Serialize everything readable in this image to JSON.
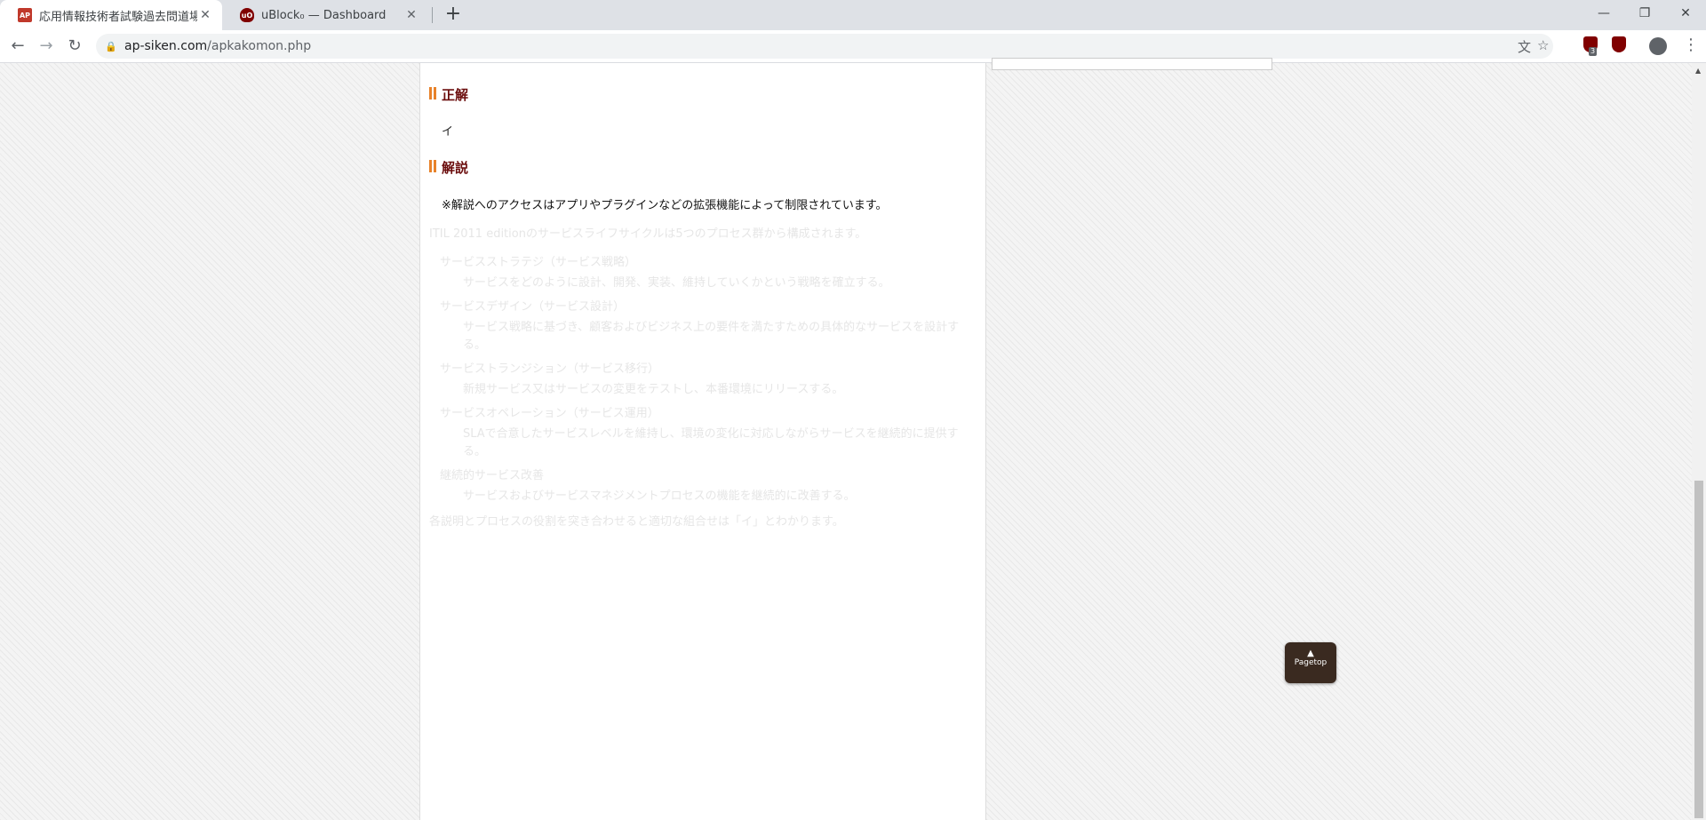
{
  "tabs": [
    {
      "title": "応用情報技術者試験過去問道場",
      "favicon": "AP",
      "close": "✕"
    },
    {
      "title": "uBlock₀ — Dashboard",
      "favicon": "uO",
      "close": "✕"
    }
  ],
  "new_tab_icon": "+",
  "window_controls": {
    "minimize": "—",
    "maximize": "❐",
    "close": "✕"
  },
  "nav": {
    "back": "←",
    "forward": "→",
    "reload": "↻"
  },
  "address": {
    "host": "ap-siken.com",
    "path": "/apkakomon.php",
    "lock_icon": "lock-icon"
  },
  "extensions": {
    "ublock_badge": "3"
  },
  "page": {
    "answer_heading": "正解",
    "answer": "イ",
    "explanation_heading": "解説",
    "notice": "※解説へのアクセスはアプリやプラグインなどの拡張機能によって制限されています。",
    "faded_intro": "ITIL 2011 editionのサービスライフサイクルは5つのプロセス群から構成されます。",
    "faded_items": [
      {
        "term": "サービスストラテジ（サービス戦略）",
        "desc": "サービスをどのように設計、開発、実装、維持していくかという戦略を確立する。"
      },
      {
        "term": "サービスデザイン（サービス設計）",
        "desc": "サービス戦略に基づき、顧客およびビジネス上の要件を満たすための具体的なサービスを設計する。"
      },
      {
        "term": "サービストランジション（サービス移行）",
        "desc": "新規サービス又はサービスの変更をテストし、本番環境にリリースする。"
      },
      {
        "term": "サービスオペレーション（サービス運用）",
        "desc": "SLAで合意したサービスレベルを維持し、環境の変化に対応しながらサービスを継続的に提供する。"
      },
      {
        "term": "継続的サービス改善",
        "desc": "サービスおよびサービスマネジメントプロセスの機能を継続的に改善する。"
      }
    ],
    "faded_conclusion": "各説明とプロセスの役割を突き合わせると適切な組合せは「イ」とわかります。",
    "pagetop_label": "Pagetop"
  }
}
